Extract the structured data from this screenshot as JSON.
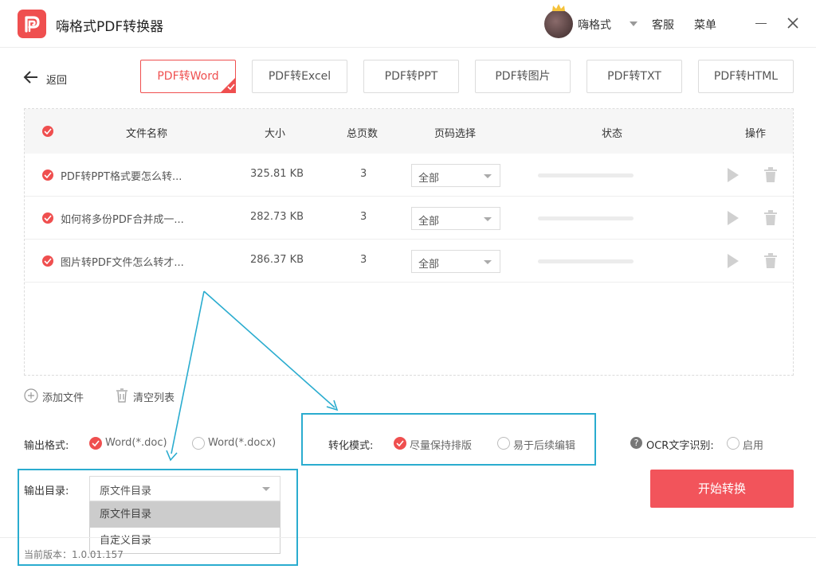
{
  "app": {
    "title": "嗨格式PDF转换器"
  },
  "header": {
    "username": "嗨格式",
    "support": "客服",
    "menu": "菜单"
  },
  "nav": {
    "back": "返回"
  },
  "tabs": [
    {
      "label": "PDF转Word",
      "active": true
    },
    {
      "label": "PDF转Excel",
      "active": false
    },
    {
      "label": "PDF转PPT",
      "active": false
    },
    {
      "label": "PDF转图片",
      "active": false
    },
    {
      "label": "PDF转TXT",
      "active": false
    },
    {
      "label": "PDF转HTML",
      "active": false
    }
  ],
  "table": {
    "columns": {
      "name": "文件名称",
      "size": "大小",
      "pages": "总页数",
      "page_select": "页码选择",
      "status": "状态",
      "action": "操作"
    },
    "rows": [
      {
        "name": "PDF转PPT格式要怎么转...",
        "size": "325.81 KB",
        "pages": "3",
        "page_select": "全部"
      },
      {
        "name": "如何将多份PDF合并成一...",
        "size": "282.73 KB",
        "pages": "3",
        "page_select": "全部"
      },
      {
        "name": "图片转PDF文件怎么转才...",
        "size": "286.37 KB",
        "pages": "3",
        "page_select": "全部"
      }
    ]
  },
  "actions": {
    "add_file": "添加文件",
    "clear_list": "清空列表"
  },
  "options": {
    "output_format_label": "输出格式:",
    "format_doc": "Word(*.doc)",
    "format_docx": "Word(*.docx)",
    "mode_label": "转化模式:",
    "mode_keep_layout": "尽量保持排版",
    "mode_easy_edit": "易于后续编辑",
    "ocr_label": "OCR文字识别:",
    "ocr_enable": "启用",
    "output_dir_label": "输出目录:",
    "output_dir_value": "原文件目录",
    "output_dir_options": [
      "原文件目录",
      "自定义目录"
    ]
  },
  "start_button": "开始转换",
  "footer": {
    "version": "当前版本：1.0.01.157"
  },
  "colors": {
    "accent": "#ef4f4f",
    "highlight": "#2aaccf"
  }
}
